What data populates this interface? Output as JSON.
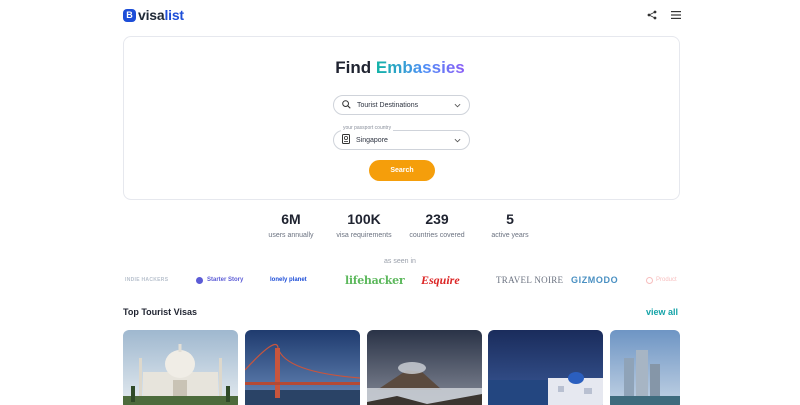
{
  "header": {
    "logo_badge": "B",
    "logo_brand": "visa",
    "logo_suffix": "list",
    "share_icon": "share-icon",
    "menu_icon": "menu-icon"
  },
  "search": {
    "title_plain": "Find",
    "title_accent": "Embassies",
    "destination_value": "Tourist Destinations",
    "passport_label": "your passport country",
    "passport_value": "Singapore",
    "button_label": "Search"
  },
  "stats": [
    {
      "value": "6M",
      "caption": "users annually"
    },
    {
      "value": "100K",
      "caption": "visa requirements"
    },
    {
      "value": "239",
      "caption": "countries covered"
    },
    {
      "value": "5",
      "caption": "active years"
    }
  ],
  "press": {
    "heading": "as seen in",
    "logos": [
      "INDIE HACKERS",
      "Starter Story",
      "lonely planet",
      "lifehacker",
      "Esquire",
      "TRAVEL NOIRE",
      "GIZMODO",
      "Product"
    ]
  },
  "section": {
    "title": "Top Tourist Visas",
    "view_all": "view all"
  },
  "tiles": [
    "taj-mahal",
    "golden-gate-bridge",
    "volcano",
    "santorini",
    "city-skyline"
  ],
  "colors": {
    "brand_blue": "#1d4ed8",
    "accent_teal": "#14a3a8",
    "button_orange": "#f59e0b"
  }
}
